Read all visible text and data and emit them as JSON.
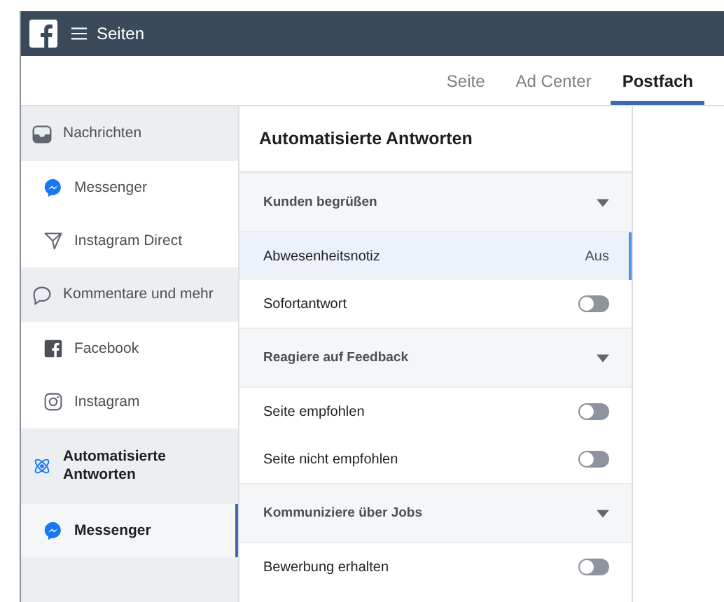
{
  "topbar": {
    "title": "Seiten"
  },
  "tabs": [
    {
      "label": "Seite",
      "selected": false
    },
    {
      "label": "Ad Center",
      "selected": false
    },
    {
      "label": "Postfach",
      "selected": true
    }
  ],
  "sidebar": {
    "items": [
      {
        "label": "Nachrichten",
        "kind": "inbox",
        "children": [
          {
            "label": "Messenger",
            "kind": "messenger",
            "selected": false
          },
          {
            "label": "Instagram Direct",
            "kind": "direct",
            "selected": false
          }
        ]
      },
      {
        "label": "Kommentare und mehr",
        "kind": "comment",
        "children": [
          {
            "label": "Facebook",
            "kind": "facebook",
            "selected": false
          },
          {
            "label": "Instagram",
            "kind": "instagram",
            "selected": false
          }
        ]
      },
      {
        "label": "Automatisierte Antworten",
        "kind": "auto",
        "children": [
          {
            "label": "Messenger",
            "kind": "messenger",
            "selected": true
          }
        ]
      }
    ]
  },
  "panel": {
    "title": "Automatisierte Antworten",
    "rows": [
      {
        "kind": "section",
        "label": "Kunden begrüßen",
        "selected": false
      },
      {
        "kind": "value",
        "label": "Abwesenheitsnotiz",
        "value": "Aus",
        "selected": true
      },
      {
        "kind": "toggle",
        "label": "Sofortantwort",
        "on": false,
        "selected": false
      },
      {
        "kind": "section",
        "label": "Reagiere auf Feedback",
        "selected": false
      },
      {
        "kind": "toggle",
        "label": "Seite empfohlen",
        "on": false,
        "selected": false
      },
      {
        "kind": "toggle",
        "label": "Seite nicht empfohlen",
        "on": false,
        "selected": false
      },
      {
        "kind": "section",
        "label": "Kommuniziere über Jobs",
        "selected": false
      },
      {
        "kind": "toggle",
        "label": "Bewerbung erhalten",
        "on": false,
        "selected": false
      }
    ]
  }
}
